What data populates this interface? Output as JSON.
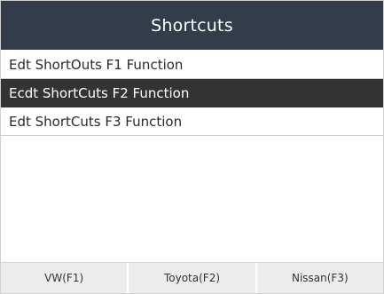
{
  "header": {
    "title": "Shortcuts"
  },
  "menu": {
    "items": [
      {
        "label": "Edt ShortOuts F1 Function",
        "selected": false
      },
      {
        "label": "Ecdt ShortCuts F2 Function",
        "selected": true
      },
      {
        "label": "Edt ShortCuts F3 Function",
        "selected": false
      }
    ]
  },
  "footer": {
    "buttons": [
      {
        "label": "VW(F1)"
      },
      {
        "label": "Toyota(F2)"
      },
      {
        "label": "Nissan(F3)"
      }
    ]
  },
  "colors": {
    "titlebar": "#333c4a",
    "selected_row": "#333333",
    "button_bg": "#ececec"
  }
}
